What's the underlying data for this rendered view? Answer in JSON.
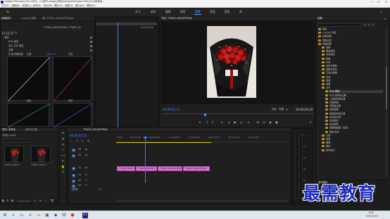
{
  "window": {
    "title": "Adobe Premiere Pro 2020 - C:\\用户\\nikap\\文档\\Adobe\\Premiere Pro\\14.0\\未命名",
    "minimize": "—",
    "maximize": "☐",
    "close": "✕"
  },
  "menu": [
    "文件(F)",
    "编辑(E)",
    "剪辑(C)",
    "序列(S)",
    "标记(M)",
    "图形(G)",
    "视图(V)",
    "窗口(W)",
    "帮助(H)"
  ],
  "workspaces": {
    "items": [
      "学习",
      "组件",
      "编辑",
      "颜色",
      "效果",
      "音频",
      "图形",
      "库"
    ],
    "active_index": 4
  },
  "effect_controls": {
    "tabs": [
      "效果控件",
      "Lumetri 范围",
      "源: TTSI03_00031PTEKKgh",
      "音频剪辑混合器: TTSI03_"
    ],
    "source_label": "主要 * TTSI03_00031PTEKKgh",
    "sequence_label": "TTSI03_00031PTEKK * TTSI03_00",
    "timecode_top": "00;00;00;00",
    "rows": [
      {
        "label": "曲线",
        "value": ""
      },
      {
        "label": "RGB 曲线",
        "value": ""
      },
      {
        "label": "显示 文本 阻挡",
        "value": ""
      },
      {
        "label": "主要",
        "value": ""
      },
      {
        "label": "白 基 调整色阶",
        "value": "100.0 %"
      }
    ],
    "graph_labels": [
      "主要",
      "红色",
      "绿色",
      "蓝色"
    ]
  },
  "program_monitor": {
    "title": "节目: TTSI03_00031PTEKK",
    "timecode": "00;00;01;11",
    "fit": "适合",
    "quality": "完整",
    "duration": "00;00;00;05",
    "controls": [
      "标记",
      "入点",
      "出点",
      "转到入点",
      "后退一帧",
      "播放",
      "前进一帧",
      "转到出点",
      "插入",
      "覆盖",
      "导出帧",
      "比较视图"
    ]
  },
  "projects": {
    "title": "效果",
    "tree": [
      {
        "label": "预设",
        "indent": 1
      },
      {
        "label": "Lumetri 预设",
        "indent": 1
      },
      {
        "label": "音频效果",
        "indent": 1
      },
      {
        "label": "音频过渡",
        "indent": 1
      },
      {
        "label": "视频效果",
        "indent": 1
      },
      {
        "label": "变换",
        "indent": 2
      },
      {
        "label": "图像控制",
        "indent": 2
      },
      {
        "label": "实用程序",
        "indent": 2
      },
      {
        "label": "扭曲",
        "indent": 2
      },
      {
        "label": "时间",
        "indent": 2
      },
      {
        "label": "杂色与颗粒",
        "indent": 2
      },
      {
        "label": "模糊与锐化",
        "indent": 2
      },
      {
        "label": "沉浸式视频",
        "indent": 2
      },
      {
        "label": "生成",
        "indent": 2
      },
      {
        "label": "视频",
        "indent": 2
      },
      {
        "label": "调整",
        "indent": 2
      },
      {
        "label": "过时",
        "indent": 2
      },
      {
        "label": "RGB 曲线",
        "indent": 3,
        "selected": true
      },
      {
        "label": "RGB 颜色校正器",
        "indent": 3
      },
      {
        "label": "三向颜色校正器",
        "indent": 3
      },
      {
        "label": "亮度曲线",
        "indent": 3
      },
      {
        "label": "亮度校正器",
        "indent": 3
      },
      {
        "label": "快速模糊",
        "indent": 3
      },
      {
        "label": "快速颜色校正器",
        "indent": 3
      },
      {
        "label": "自动对比度",
        "indent": 3
      },
      {
        "label": "自动色阶",
        "indent": 3
      },
      {
        "label": "自动颜色",
        "indent": 3
      },
      {
        "label": "视频限幅器（旧版）",
        "indent": 3
      },
      {
        "label": "阴影/高光",
        "indent": 3
      },
      {
        "label": "过渡",
        "indent": 2
      },
      {
        "label": "透视",
        "indent": 2
      },
      {
        "label": "通道",
        "indent": 2
      },
      {
        "label": "键控",
        "indent": 2
      },
      {
        "label": "颜色校正",
        "indent": 2
      }
    ],
    "footer_label": "基本图形"
  },
  "bin": {
    "tabs": [
      "项目: 未命名",
      "媒体浏览器"
    ],
    "path": "未命名.prproj",
    "items": [
      {
        "name": "TTSI03_00031..."
      },
      {
        "name": "TTSI03_00031..."
      }
    ]
  },
  "tools": [
    "选择工具",
    "向前选择轨道工具",
    "波纹编辑工具",
    "剃刀工具",
    "外滑工具",
    "钢笔工具",
    "手形工具",
    "文字工具"
  ],
  "timeline": {
    "title": "TTSI03_00031PTEKK",
    "timecode": "00;00;01;11",
    "ruler": [
      "00;00",
      "00;00;02;00",
      "00;00;04;00",
      "00;00;06;00",
      "00;00;08;00",
      "00;00;10;00",
      "00;00;12;00",
      "00;00;14;00"
    ],
    "tracks": [
      {
        "name": "V3"
      },
      {
        "name": "V2"
      },
      {
        "name": "V1"
      },
      {
        "name": "A1"
      },
      {
        "name": "A2"
      },
      {
        "name": "A3"
      }
    ],
    "master": "主声道",
    "master_value": "0.0",
    "clips": [
      {
        "label": "TTSI03_00031"
      },
      {
        "label": "TTSI03_00030H"
      },
      {
        "label": "TTSI03_00031PTEKK_4"
      },
      {
        "label": "TTSI03_00031PTEKK"
      }
    ]
  },
  "meters": {
    "scale": [
      "0",
      "-12",
      "-24",
      "-36",
      "-48",
      "dB"
    ]
  },
  "watermark": "最需教育",
  "taskbar": {
    "time": "8:53",
    "date": "2021/7/19",
    "apps": [
      "windows-icon",
      "search-icon",
      "task-view-icon",
      "edge-icon",
      "explorer-icon",
      "store-icon",
      "premiere-icon",
      "word-icon",
      "app-icon"
    ]
  },
  "colors": {
    "accent": "#3f8cff",
    "clip": "#d976d4",
    "watermark": "#1f2dbf"
  }
}
